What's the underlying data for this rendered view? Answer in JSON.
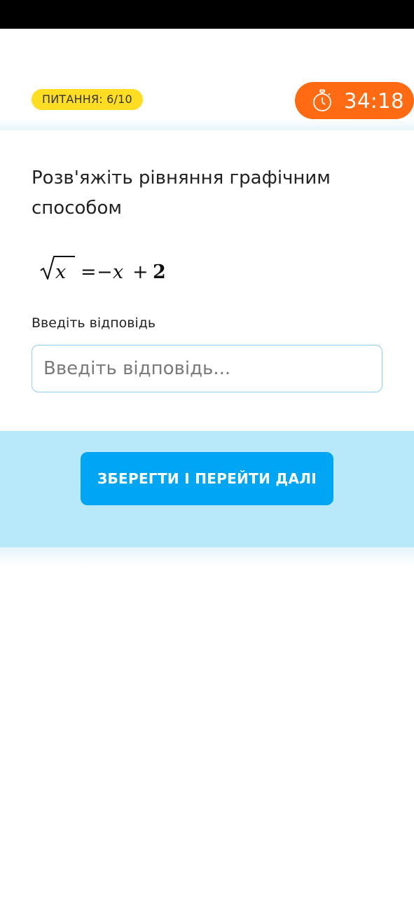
{
  "header": {
    "question_counter": "ПИТАННЯ: 6/10",
    "timer_icon": "stopwatch-icon",
    "timer_value": "34:18"
  },
  "question": {
    "text": "Розв'яжіть рівняння графічним способом",
    "formula_parts": {
      "radicand": "x",
      "equals": "=",
      "rhs_minus": "−",
      "rhs_var": "x",
      "rhs_plus": "+",
      "rhs_const": "2"
    }
  },
  "answer": {
    "label": "Введіть відповідь",
    "placeholder": "Введіть відповідь...",
    "value": ""
  },
  "footer": {
    "save_button_label": "ЗБЕРЕГТИ І ПЕРЕЙТИ ДАЛІ"
  },
  "colors": {
    "badge_bg": "#ffdd22",
    "timer_bg": "#ff6a13",
    "button_bg": "#00a6f4",
    "footer_bg": "#b8e9fb",
    "input_border": "#8ecdf0"
  }
}
